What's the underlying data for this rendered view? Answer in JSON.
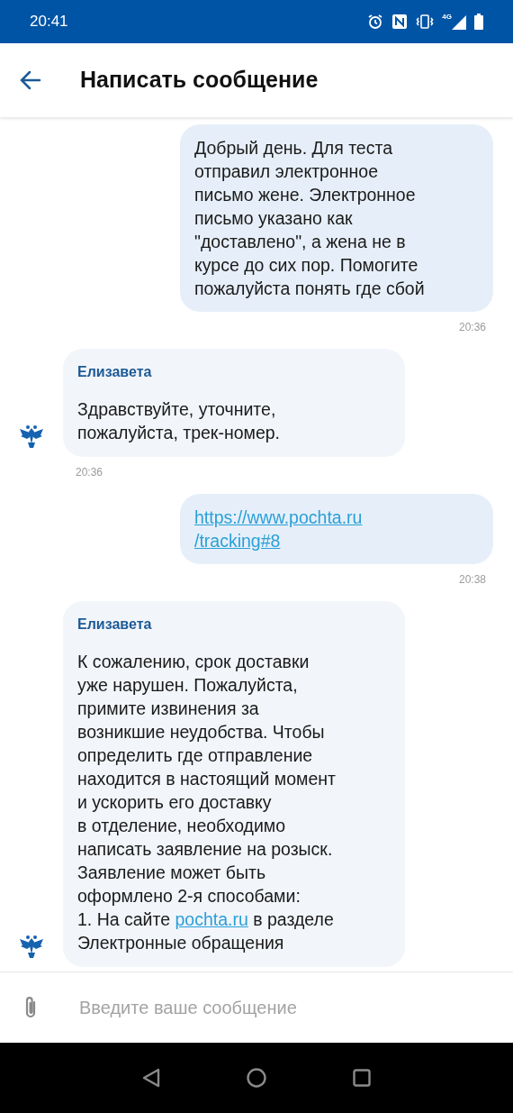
{
  "status_bar": {
    "time": "20:41",
    "network": "4G"
  },
  "header": {
    "title": "Написать сообщение"
  },
  "messages": [
    {
      "kind": "outgoing",
      "parts": [
        {
          "kind": "text",
          "text": "Добрый день. Для теста\nотправил электронное\nписьмо жене. Электронное\nписьмо указано как\n\"доставлено\", а жена не в\nкурсе до сих пор. Помогите\nпожалуйста понять где сбой"
        }
      ],
      "time": "20:36"
    },
    {
      "kind": "incoming",
      "sender": "Елизавета",
      "parts": [
        {
          "kind": "text",
          "text": "Здравствуйте, уточните,\nпожалуйста, трек-номер."
        }
      ],
      "time": "20:36"
    },
    {
      "kind": "outgoing",
      "parts": [
        {
          "kind": "link",
          "text": "https://www.pochta.ru\n/tracking#8"
        }
      ],
      "time": "20:38"
    },
    {
      "kind": "incoming",
      "sender": "Елизавета",
      "parts": [
        {
          "kind": "text",
          "text": "К сожалению, срок доставки\nуже нарушен. Пожалуйста,\nпримите извинения за\nвозникшие неудобства. Чтобы\nопределить где отправление\nнаходится в настоящий момент\nи ускорить его доставку\nв отделение, необходимо\nнаписать заявление на розыск.\nЗаявление может быть\nоформлено 2-я способами:\n1. На сайте "
        },
        {
          "kind": "link",
          "text": "pochta.ru"
        },
        {
          "kind": "text",
          "text": " в разделе\nЭлектронные обращения"
        }
      ]
    }
  ],
  "composer": {
    "placeholder": "Введите ваше сообщение"
  }
}
